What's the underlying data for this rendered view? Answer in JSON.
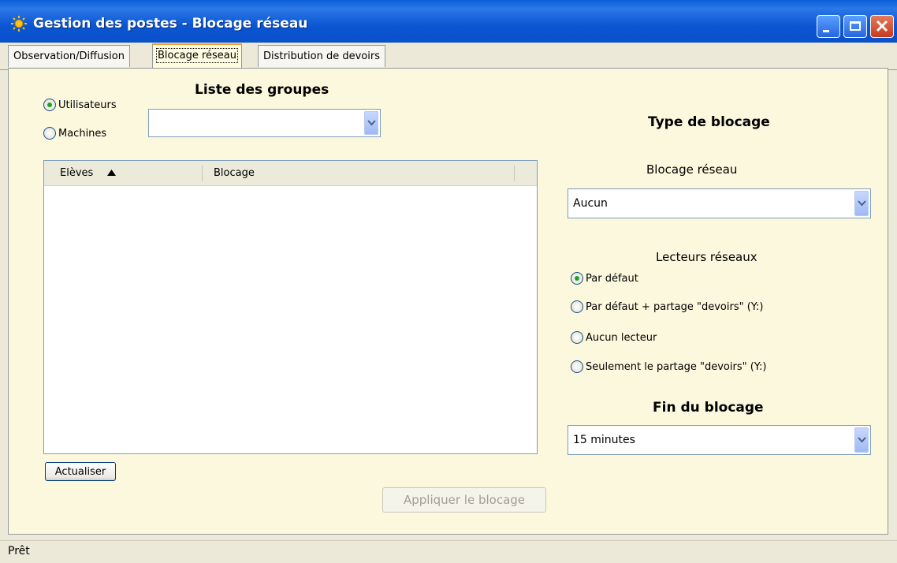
{
  "window": {
    "title": "Gestion des postes - Blocage réseau",
    "icon": "app-sun-icon",
    "colors": {
      "titlebar": "#0a55d2",
      "panel": "#fbf8dd",
      "active_tab_accent": "#f0a030"
    }
  },
  "tabs": [
    {
      "label": "Observation/Diffusion",
      "active": false
    },
    {
      "label": "Blocage réseau",
      "active": true
    },
    {
      "label": "Distribution de devoirs",
      "active": false
    }
  ],
  "left": {
    "radios": [
      {
        "label": "Utilisateurs",
        "selected": true
      },
      {
        "label": "Machines",
        "selected": false
      }
    ],
    "groups_heading": "Liste des groupes",
    "groups_value": "",
    "list": {
      "columns": [
        "Elèves",
        "Blocage"
      ],
      "sort_column": "Elèves",
      "sort_direction": "ascending",
      "rows": []
    },
    "refresh_label": "Actualiser"
  },
  "right": {
    "type_heading": "Type de blocage",
    "network_label": "Blocage réseau",
    "network_value": "Aucun",
    "drives_label": "Lecteurs réseaux",
    "drives_options": [
      {
        "label": "Par défaut",
        "selected": true
      },
      {
        "label": "Par défaut + partage \"devoirs\" (Y:)",
        "selected": false
      },
      {
        "label": "Aucun lecteur",
        "selected": false
      },
      {
        "label": "Seulement le partage \"devoirs\" (Y:)",
        "selected": false
      }
    ],
    "end_heading": "Fin du blocage",
    "end_value": "15 minutes"
  },
  "apply_label": "Appliquer le blocage",
  "status": "Prêt"
}
